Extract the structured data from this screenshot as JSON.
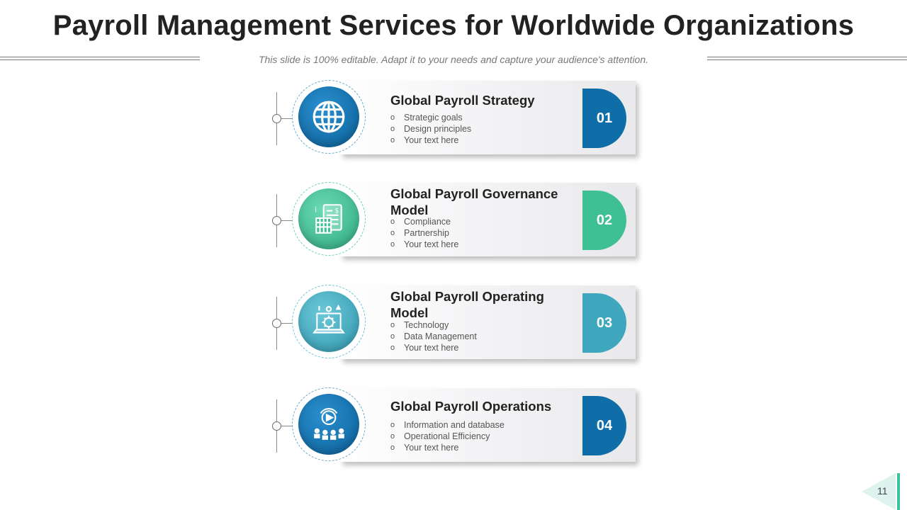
{
  "header": {
    "title": "Payroll Management Services for Worldwide Organizations",
    "subtitle": "This slide is 100% editable. Adapt it to your needs and capture your audience's attention."
  },
  "bullet_glyph": "o",
  "items": [
    {
      "title": "Global Payroll Strategy",
      "bullets": [
        "Strategic goals",
        "Design principles",
        "Your text here"
      ],
      "number": "01",
      "icon": "globe-icon",
      "color": "#0f6ea8"
    },
    {
      "title": "Global Payroll Governance Model",
      "bullets": [
        "Compliance",
        "Partnership",
        "Your text here"
      ],
      "number": "02",
      "icon": "payroll-document-icon",
      "color": "#3fbf94"
    },
    {
      "title": "Global Payroll Operating Model",
      "bullets": [
        "Technology",
        "Data Management",
        "Your text here"
      ],
      "number": "03",
      "icon": "laptop-gear-icon",
      "color": "#3ea7bd"
    },
    {
      "title": "Global Payroll Operations",
      "bullets": [
        "Information  and database",
        "Operational  Efficiency",
        "Your text here"
      ],
      "number": "04",
      "icon": "operations-people-icon",
      "color": "#0f6ea8"
    }
  ],
  "footer": {
    "page_number": "11"
  }
}
